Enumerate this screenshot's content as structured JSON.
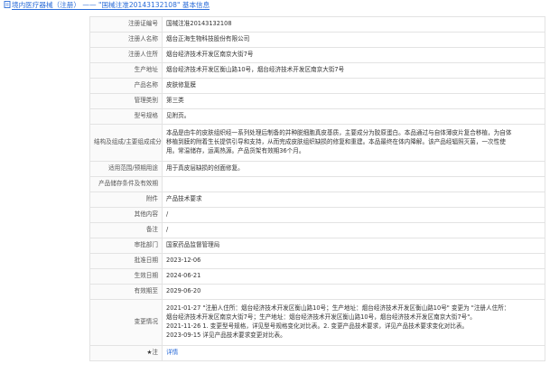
{
  "header": {
    "title": "境内医疗器械（注册） —— \"国械注准20143132108\" 基本信息"
  },
  "rows": {
    "reg_no": {
      "label": "注册证编号",
      "value": "国械注准20143132108"
    },
    "registrant": {
      "label": "注册人名称",
      "value": "烟台正海生物科技股份有限公司"
    },
    "address": {
      "label": "注册人住所",
      "value": "烟台经济技术开发区南京大街7号"
    },
    "prod_address": {
      "label": "生产地址",
      "value": "烟台经济技术开发区衡山路10号，烟台经济技术开发区南京大街7号"
    },
    "product_name": {
      "label": "产品名称",
      "value": "皮肤修复膜"
    },
    "category": {
      "label": "管理类别",
      "value": "第三类"
    },
    "model": {
      "label": "型号规格",
      "value": "见附页。"
    },
    "structure": {
      "label": "结构及组成/主要组成成分",
      "lines": [
        "本品是由牛的皮肤组织经一系列处理后制备的并种脱细胞真皮基质，主要成分为胶原蛋白。本品通过与自体薄皮片复合移植，为自体",
        "移植到膜的附着生长提供引导和支持，从而完成皮肤组织缺损的修复和重建。本品最终在体内降解。该产品经辐照灭菌，一次性使",
        "用。常温储存，运离热源。产品货架有效期36个月。"
      ]
    },
    "scope": {
      "label": "适用范围/预期用途",
      "value": "用于真皮层缺损的创面修复。"
    },
    "storage": {
      "label": "产品储存条件及有效期",
      "value": ""
    },
    "attachment": {
      "label": "附件",
      "value": "产品技术要求"
    },
    "other": {
      "label": "其他内容",
      "value": "/"
    },
    "remark": {
      "label": "备注",
      "value": "/"
    },
    "approver": {
      "label": "审批部门",
      "value": "国家药品监督管理局"
    },
    "approve_date": {
      "label": "批准日期",
      "value": "2023-12-06"
    },
    "effective_date": {
      "label": "生效日期",
      "value": "2024-06-21"
    },
    "expiry_date": {
      "label": "有效期至",
      "value": "2029-06-20"
    },
    "changes": {
      "label": "变更情况",
      "lines": [
        "2021-01-27 \"注册人住所：烟台经济技术开发区衡山路10号；生产地址：烟台经济技术开发区衡山路10号\" 变更为 \"注册人住所：",
        "烟台经济技术开发区南京大街7号；生产地址：烟台经济技术开发区衡山路10号，烟台经济技术开发区南京大街7号\"。",
        "2021-11-26 1. 变更型号规格，详见型号规格变化对比表。2. 变更产品技术要求，详见产品技术要求变化对比表。",
        "2023-09-15 详见产品技术要求变更对比表。"
      ]
    },
    "note": {
      "label": "注",
      "value": "详情"
    }
  }
}
